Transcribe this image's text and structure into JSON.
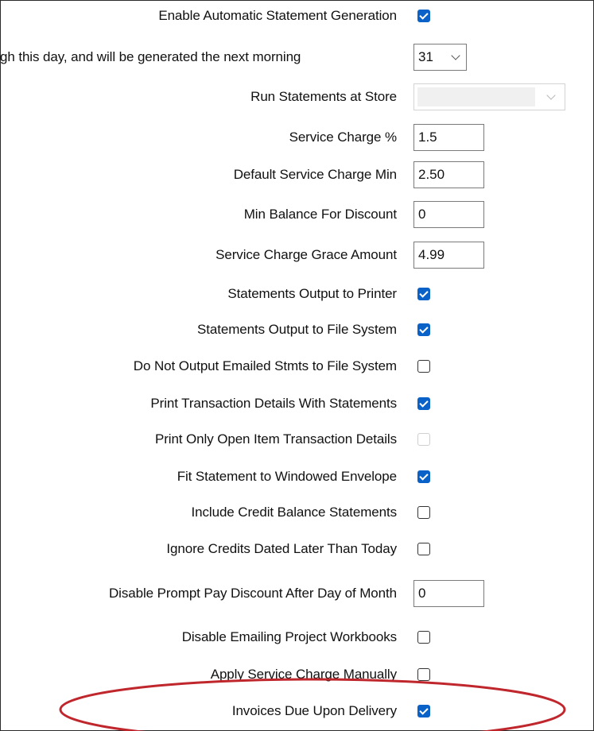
{
  "settings": {
    "enable_auto": {
      "label": "Enable Automatic Statement Generation",
      "checked": true
    },
    "statement_day": {
      "label": "gh this day, and will be generated the next morning",
      "value": "31"
    },
    "run_at_store": {
      "label": "Run Statements at Store",
      "value": ""
    },
    "service_charge_pct": {
      "label": "Service Charge %",
      "value": "1.5"
    },
    "default_sc_min": {
      "label": "Default Service Charge Min",
      "value": "2.50"
    },
    "min_balance_discount": {
      "label": "Min Balance For Discount",
      "value": "0"
    },
    "sc_grace_amount": {
      "label": "Service Charge Grace Amount",
      "value": "4.99"
    },
    "output_printer": {
      "label": "Statements Output to Printer",
      "checked": true
    },
    "output_file_system": {
      "label": "Statements Output to File System",
      "checked": true
    },
    "no_output_emailed": {
      "label": "Do Not Output Emailed Stmts to File System",
      "checked": false
    },
    "print_txn_details": {
      "label": "Print Transaction Details With Statements",
      "checked": true
    },
    "print_open_item": {
      "label": "Print Only Open Item Transaction Details",
      "checked": false,
      "disabled": true
    },
    "fit_windowed_envelope": {
      "label": "Fit Statement to Windowed Envelope",
      "checked": true
    },
    "include_credit_balance": {
      "label": "Include Credit Balance Statements",
      "checked": false
    },
    "ignore_credits_later": {
      "label": "Ignore Credits Dated Later Than Today",
      "checked": false
    },
    "disable_prompt_pay_day": {
      "label": "Disable Prompt Pay Discount After Day of Month",
      "value": "0"
    },
    "disable_emailing_workbooks": {
      "label": "Disable Emailing Project Workbooks",
      "checked": false
    },
    "apply_sc_manually": {
      "label": "Apply Service Charge Manually",
      "checked": false
    },
    "invoices_due_delivery": {
      "label": "Invoices Due Upon Delivery",
      "checked": true
    }
  },
  "colors": {
    "checkbox_checked": "#0a62c8",
    "highlight_ellipse": "#c0272d"
  },
  "icons": {
    "dropdown": "chevron-down-icon",
    "check": "checkmark-icon"
  }
}
